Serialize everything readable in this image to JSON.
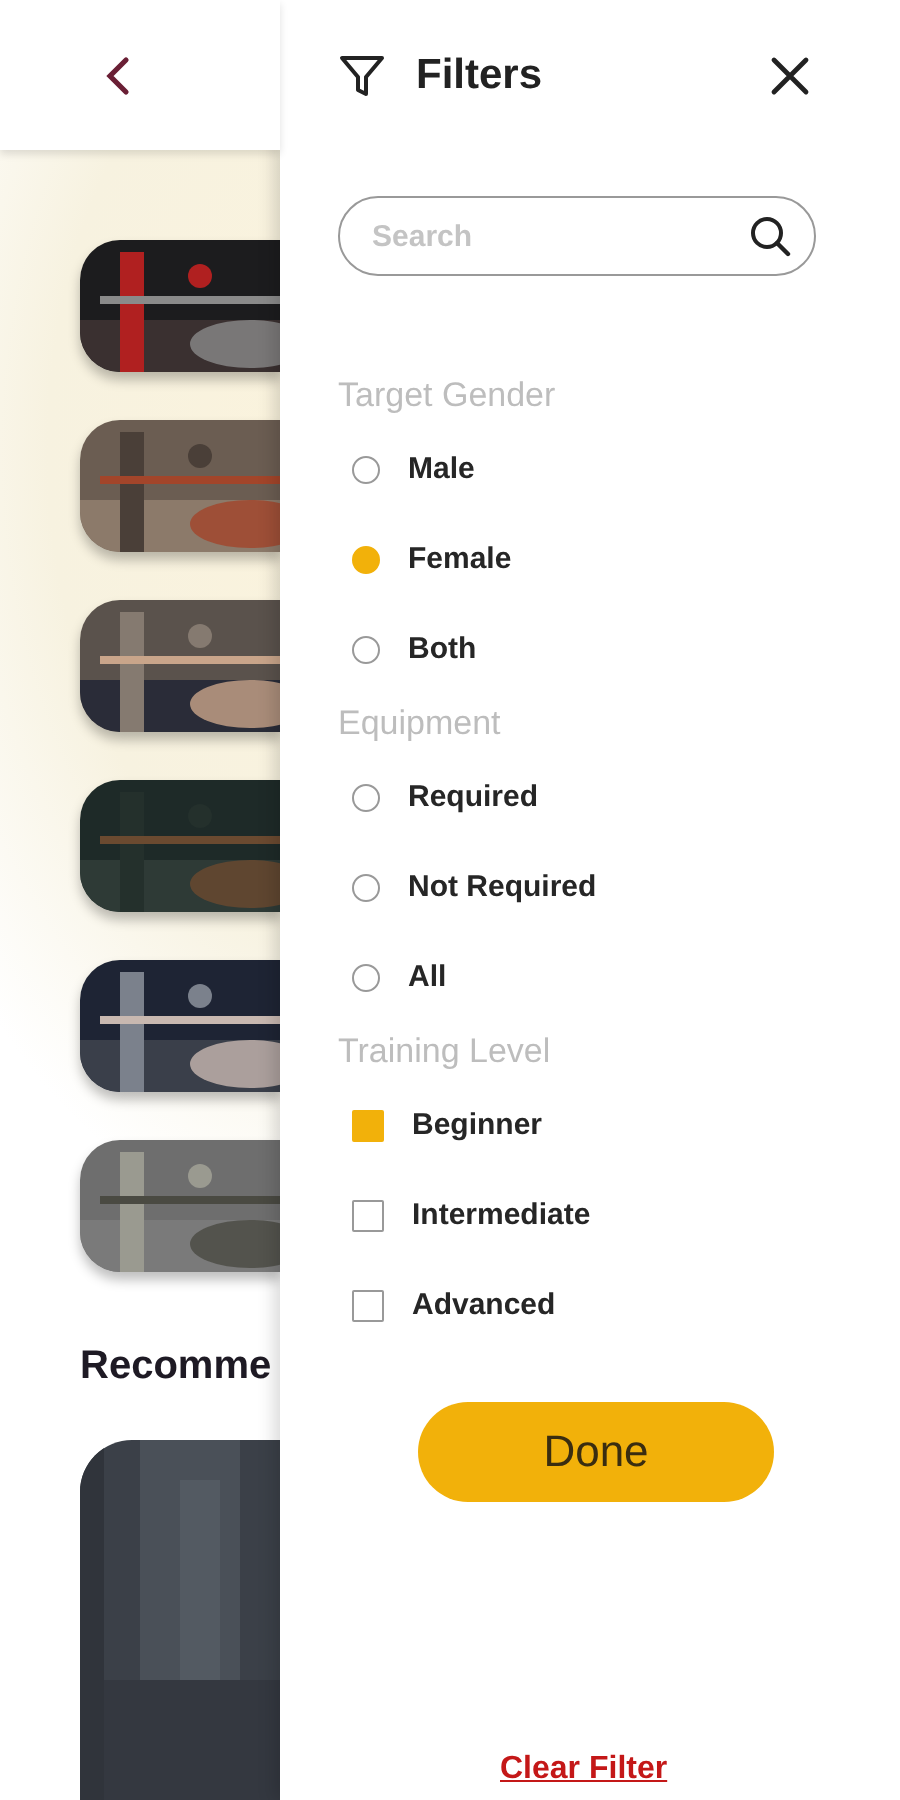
{
  "page": {
    "section_title": "Recomme"
  },
  "filters": {
    "title": "Filters",
    "search": {
      "placeholder": "Search"
    },
    "groups": [
      {
        "title": "Target Gender",
        "kind": "radio",
        "options": [
          {
            "label": "Male",
            "selected": false
          },
          {
            "label": "Female",
            "selected": true
          },
          {
            "label": "Both",
            "selected": false
          }
        ]
      },
      {
        "title": "Equipment",
        "kind": "radio",
        "options": [
          {
            "label": "Required",
            "selected": false
          },
          {
            "label": "Not Required",
            "selected": false
          },
          {
            "label": "All",
            "selected": false
          }
        ]
      },
      {
        "title": "Training Level",
        "kind": "checkbox",
        "options": [
          {
            "label": "Beginner",
            "selected": true
          },
          {
            "label": "Intermediate",
            "selected": false
          },
          {
            "label": "Advanced",
            "selected": false
          }
        ]
      }
    ],
    "done_button": "Done",
    "clear_link": "Clear Filter"
  }
}
